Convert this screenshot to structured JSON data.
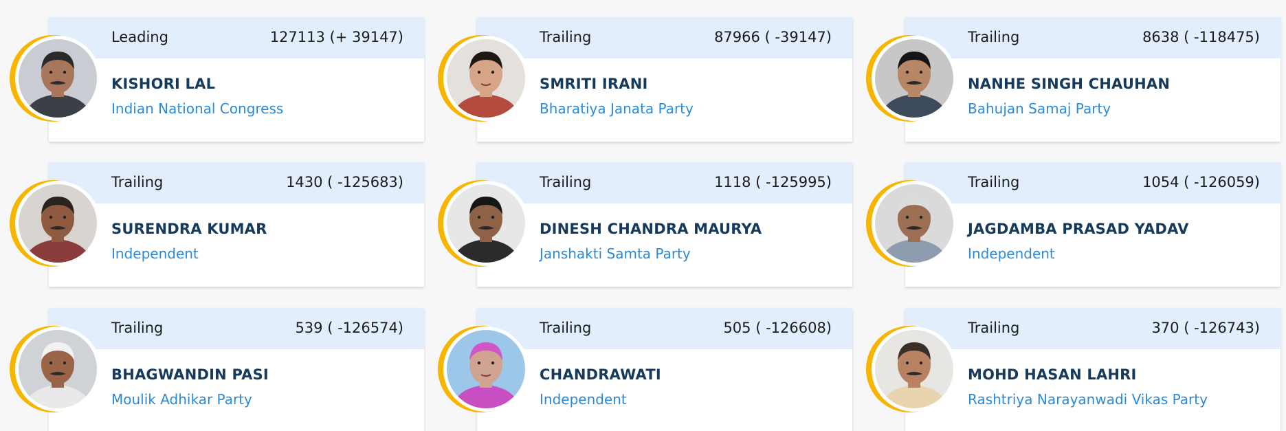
{
  "candidates": [
    {
      "status": "Leading",
      "votes": "127113 (+ 39147)",
      "name": "KISHORI LAL",
      "party": "Indian National Congress",
      "photo": {
        "bg": "#c9ccd2",
        "skin": "#a8765a",
        "hair": "#2a2a2a",
        "cloth": "#3b4047",
        "mustache": true
      }
    },
    {
      "status": "Trailing",
      "votes": "87966 ( -39147)",
      "name": "SMRITI IRANI",
      "party": "Bharatiya Janata Party",
      "photo": {
        "bg": "#e4e1dc",
        "skin": "#d6a486",
        "hair": "#1f1712",
        "cloth": "#b34b3f",
        "mustache": false
      }
    },
    {
      "status": "Trailing",
      "votes": "8638 ( -118475)",
      "name": "NANHE SINGH CHAUHAN",
      "party": "Bahujan Samaj Party",
      "photo": {
        "bg": "#c7c7c7",
        "skin": "#b68665",
        "hair": "#151515",
        "cloth": "#3c4a5c",
        "mustache": true
      }
    },
    {
      "status": "Trailing",
      "votes": "1430 ( -125683)",
      "name": "SURENDRA KUMAR",
      "party": "Independent",
      "photo": {
        "bg": "#d8d4cf",
        "skin": "#8f5a40",
        "hair": "#2a2421",
        "cloth": "#8b3d3d",
        "mustache": true
      }
    },
    {
      "status": "Trailing",
      "votes": "1118 ( -125995)",
      "name": "DINESH CHANDRA MAURYA",
      "party": "Janshakti Samta Party",
      "photo": {
        "bg": "#e7e7e7",
        "skin": "#8f6247",
        "hair": "#161616",
        "cloth": "#2b2b2b",
        "mustache": true
      }
    },
    {
      "status": "Trailing",
      "votes": "1054 ( -126059)",
      "name": "JAGDAMBA PRASAD YADAV",
      "party": "Independent",
      "photo": {
        "bg": "#dadada",
        "skin": "#9c6f55",
        "hair": "#dcdcdc",
        "cloth": "#8e9cb0",
        "mustache": true
      }
    },
    {
      "status": "Trailing",
      "votes": "539 ( -126574)",
      "name": "BHAGWANDIN PASI",
      "party": "Moulik Adhikar Party",
      "photo": {
        "bg": "#cfd2d6",
        "skin": "#9a6449",
        "hair": "#f2f2f2",
        "cloth": "#e9e9e9",
        "mustache": true
      }
    },
    {
      "status": "Trailing",
      "votes": "505 ( -126608)",
      "name": "CHANDRAWATI",
      "party": "Independent",
      "photo": {
        "bg": "#9cc7e8",
        "skin": "#cfa390",
        "hair": "#d057c8",
        "cloth": "#c84fc2",
        "mustache": false
      }
    },
    {
      "status": "Trailing",
      "votes": "370 ( -126743)",
      "name": "MOHD HASAN LAHRI",
      "party": "Rashtriya Narayanwadi Vikas Party",
      "photo": {
        "bg": "#e8e6e2",
        "skin": "#b88262",
        "hair": "#3a3027",
        "cloth": "#e8d5b0",
        "mustache": true
      }
    }
  ],
  "colors": {
    "accent_arc": "#f7b500",
    "header_bg": "#e3eefc",
    "name_text": "#163a5c",
    "party_text": "#2a8ad8"
  }
}
